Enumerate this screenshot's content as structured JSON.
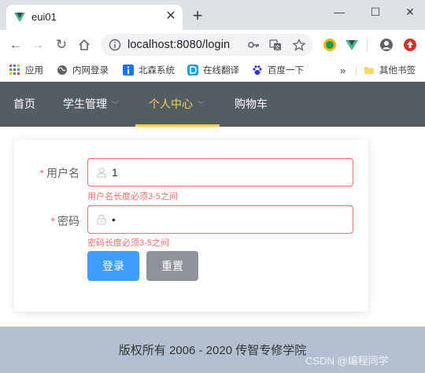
{
  "browser": {
    "tab": {
      "title": "eui01"
    },
    "window_controls": {
      "minimize": "—",
      "restore": "☐",
      "close": "✕"
    },
    "toolbar": {
      "url": "localhost:8080/login"
    },
    "bookmarks": [
      {
        "label": "应用",
        "icon": "apps-grid-icon",
        "color": "#ea4335"
      },
      {
        "label": "内网登录",
        "icon": "globe-icon",
        "color": "#5f6368"
      },
      {
        "label": "北森系统",
        "icon": "info-icon",
        "color": "#1a73e8"
      },
      {
        "label": "在线翻译",
        "icon": "translate-d-icon",
        "color": "#1ba1e2"
      },
      {
        "label": "百度一下",
        "icon": "baidu-paw-icon",
        "color": "#2932e1"
      }
    ],
    "bookmarks_more": "»",
    "other_bookmarks": "其他书签"
  },
  "app": {
    "nav": [
      {
        "label": "首页",
        "has_submenu": false,
        "active": false
      },
      {
        "label": "学生管理",
        "has_submenu": true,
        "active": false
      },
      {
        "label": "个人中心",
        "has_submenu": true,
        "active": true
      },
      {
        "label": "购物车",
        "has_submenu": false,
        "active": false
      }
    ],
    "login_form": {
      "required_mark": "*",
      "username": {
        "label": "用户名",
        "value": "1",
        "error": "用户名长度必须3-5之间"
      },
      "password": {
        "label": "密码",
        "value": "•",
        "error": "密码长度必须3-5之间"
      },
      "submit_label": "登录",
      "reset_label": "重置"
    },
    "footer": {
      "text": "版权所有 2006 - 2020 传智专修学院"
    }
  },
  "watermark": "CSDN @编程同学",
  "colors": {
    "navbar_bg": "#545c64",
    "nav_active": "#ffd04b",
    "error": "#f56c6c",
    "primary": "#409eff",
    "reset": "#909399",
    "footer_bg": "#b3c0d1"
  }
}
